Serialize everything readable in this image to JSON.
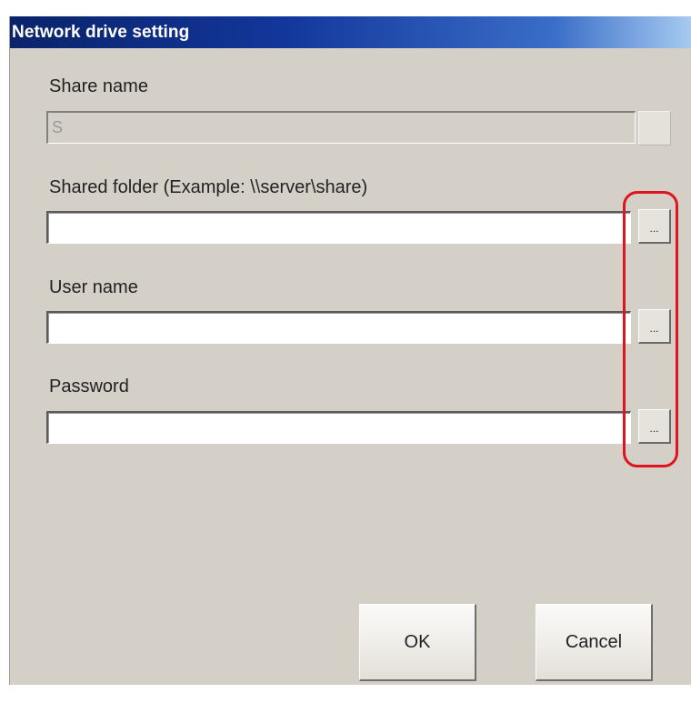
{
  "window": {
    "title": "Network drive setting"
  },
  "fields": {
    "share_name": {
      "label": "Share name",
      "value": "S"
    },
    "shared_folder": {
      "label": "Shared folder (Example:  \\\\server\\share)",
      "value": "",
      "browse_label": "..."
    },
    "user_name": {
      "label": "User name",
      "value": "",
      "browse_label": "..."
    },
    "password": {
      "label": "Password",
      "value": "",
      "browse_label": "..."
    }
  },
  "buttons": {
    "ok_label": "OK",
    "cancel_label": "Cancel"
  },
  "colors": {
    "title_bar_start": "#0a246a",
    "title_bar_end": "#a6caf0",
    "dialog_background": "#d4d0c8",
    "highlight_outline": "#e0141e"
  }
}
